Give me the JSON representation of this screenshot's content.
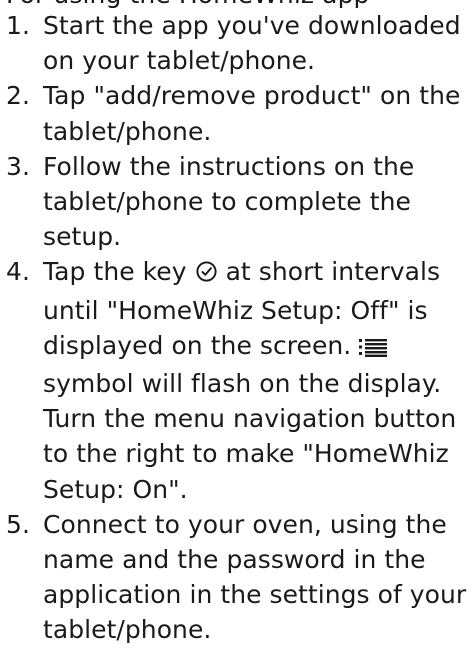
{
  "heading_clipped": "For using the HomeWhiz app",
  "steps": [
    {
      "number": "1.",
      "text": "Start the app you've downloaded on your tablet/phone."
    },
    {
      "number": "2.",
      "text": "Tap \"add/remove product\" on the tablet/phone."
    },
    {
      "number": "3.",
      "text": "Follow the instructions on the tablet/phone to complete the setup."
    },
    {
      "number": "4.",
      "text_before_icon": "Tap the key",
      "key_icon": "timer-clock-icon",
      "text_after_icon": "at short intervals until \"HomeWhiz Setup: Off\" is displayed on the screen.",
      "status_icon": "homewhiz-list-icon",
      "text_after_status_icon": "symbol will flash on the display. Turn the menu navigation button to the right to make \"HomeWhiz Setup: On\"."
    },
    {
      "number": "5.",
      "text": "Connect to your oven, using the name and the password in the application in the settings of your tablet/phone."
    }
  ]
}
